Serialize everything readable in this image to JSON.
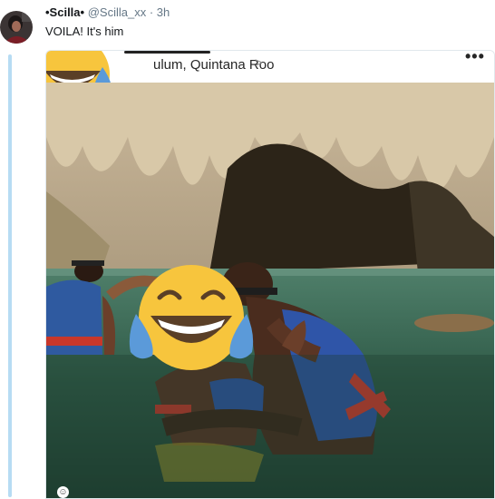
{
  "tweet": {
    "display_name": "•Scilla•",
    "handle": "@Scilla_xx",
    "separator": "·",
    "time": "3h",
    "text": "VOILA! It's him"
  },
  "media": {
    "location_text": "ulum, Quintana Roo",
    "chevron": ">",
    "more": "•••",
    "badge": "☺"
  },
  "icons": [
    "laughing-crying-emoji-icon",
    "more-icon",
    "chevron-right-icon",
    "face-badge-icon"
  ],
  "colors": {
    "thread_line": "#b7dcf3",
    "secondary_text": "#657786",
    "emoji_yellow": "#f7c53d",
    "tear_blue": "#5b9ad9"
  }
}
